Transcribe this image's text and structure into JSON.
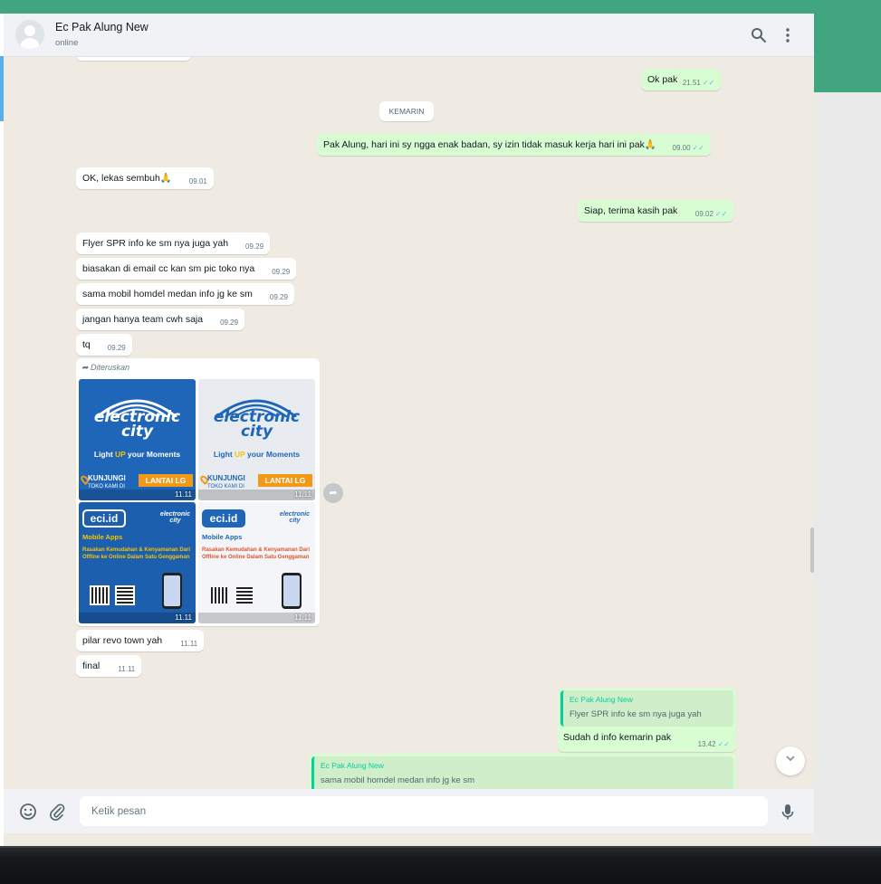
{
  "header": {
    "contact_name": "Ec Pak Alung New",
    "status": "online",
    "icons": [
      "search-icon",
      "menu-kebab-icon"
    ]
  },
  "date_divider": "KEMARIN",
  "messages": [
    {
      "dir": "out",
      "text": "Ok pak",
      "time": "21.51",
      "read": true
    },
    {
      "dir": "out",
      "text": "Pak Alung, hari ini sy ngga enak badan, sy izin tidak masuk kerja hari ini pak🙏",
      "time": "09.00",
      "read": true
    },
    {
      "dir": "in",
      "text": "OK, lekas sembuh🙏",
      "time": "09.01"
    },
    {
      "dir": "out",
      "text": "Siap, terima kasih pak",
      "time": "09.02",
      "read": true
    },
    {
      "dir": "in",
      "text": "Flyer SPR info ke sm nya juga yah",
      "time": "09.29"
    },
    {
      "dir": "in",
      "text": "biasakan di email cc kan sm pic toko nya",
      "time": "09.29"
    },
    {
      "dir": "in",
      "text": "sama mobil homdel medan info jg ke sm",
      "time": "09.29"
    },
    {
      "dir": "in",
      "text": "jangan hanya team cwh saja",
      "time": "09.29"
    },
    {
      "dir": "in",
      "text": "tq",
      "time": "09.29"
    },
    {
      "dir": "in",
      "text": "pilar revo town yah",
      "time": "11.11"
    },
    {
      "dir": "in",
      "text": "final",
      "time": "11.11"
    }
  ],
  "forwarded": {
    "label": "Diteruskan",
    "images": [
      {
        "brand_line1": "electronic",
        "brand_line2": "city",
        "tagline_pre": "Light ",
        "tagline_up": "UP",
        "tagline_post": " your Moments",
        "cta": "KUNJUNGI",
        "cta_sub": "TOKO KAMI DI",
        "badge": "LANTAI LG",
        "time": "11.11"
      },
      {
        "brand_line1": "electronic",
        "brand_line2": "city",
        "tagline_pre": "Light ",
        "tagline_up": "UP",
        "tagline_post": " your Moments",
        "cta": "KUNJUNGI",
        "cta_sub": "TOKO KAMI DI",
        "badge": "LANTAI LG",
        "time": "11.11"
      },
      {
        "logo": "eci.id",
        "brand_small1": "electronic",
        "brand_small2": "city",
        "title": "Mobile Apps",
        "body": "Rasakan Kemudahan & Kenyamanan Dari Offline ke Online Dalam Satu Genggaman",
        "time": "11.11"
      },
      {
        "logo": "eci.id",
        "brand_small1": "electronic",
        "brand_small2": "city",
        "title": "Mobile Apps",
        "body": "Rasakan Kemudahan & Kenyamanan Dari Offline ke Online Dalam Satu Genggaman",
        "time": "11.11"
      }
    ]
  },
  "reply1": {
    "quote_author": "Ec Pak Alung New",
    "quote_text": "Flyer SPR info ke sm nya juga yah",
    "text": "Sudah d info kemarin pak",
    "time": "13.42",
    "read": true
  },
  "reply2": {
    "quote_author": "Ec Pak Alung New",
    "quote_text": "sama mobil homdel medan info jg ke sm"
  },
  "composer": {
    "placeholder": "Ketik pesan"
  },
  "colors": {
    "accent": "#41a57f",
    "outgoing": "#d9fdd3",
    "incoming": "#ffffff",
    "read_tick": "#53bdeb",
    "chat_bg": "#efeae2"
  }
}
